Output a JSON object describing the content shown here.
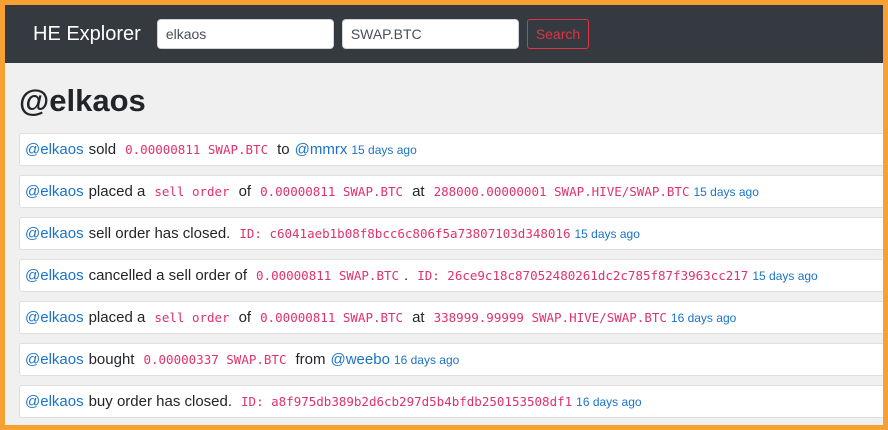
{
  "navbar": {
    "brand": "HE Explorer",
    "account_input_value": "elkaos",
    "symbol_input_value": "SWAP.BTC",
    "search_label": "Search"
  },
  "page": {
    "title": "@elkaos"
  },
  "entries": [
    {
      "user": "@elkaos",
      "text1": "sold",
      "amount": "0.00000811 SWAP.BTC",
      "text2": "to",
      "counterparty": "@mmrx",
      "time": "15 days ago"
    },
    {
      "user": "@elkaos",
      "text1": "placed a",
      "order_type": "sell order",
      "text2": "of",
      "amount": "0.00000811 SWAP.BTC",
      "text3": "at",
      "price": "288000.00000001 SWAP.HIVE/SWAP.BTC",
      "time": "15 days ago"
    },
    {
      "user": "@elkaos",
      "text1": "sell order has closed.",
      "order_id": "ID: c6041aeb1b08f8bcc6c806f5a73807103d348016",
      "time": "15 days ago"
    },
    {
      "user": "@elkaos",
      "text1": "cancelled a sell order of",
      "amount": "0.00000811 SWAP.BTC",
      "text2": ".",
      "order_id": "ID: 26ce9c18c87052480261dc2c785f87f3963cc217",
      "time": "15 days ago"
    },
    {
      "user": "@elkaos",
      "text1": "placed a",
      "order_type": "sell order",
      "text2": "of",
      "amount": "0.00000811 SWAP.BTC",
      "text3": "at",
      "price": "338999.99999 SWAP.HIVE/SWAP.BTC",
      "time": "16 days ago"
    },
    {
      "user": "@elkaos",
      "text1": "bought",
      "amount": "0.00000337 SWAP.BTC",
      "text2": "from",
      "counterparty": "@weebo",
      "time": "16 days ago"
    },
    {
      "user": "@elkaos",
      "text1": "buy order has closed.",
      "order_id": "ID: a8f975db389b2d6cb297d5b4bfdb250153508df1",
      "time": "16 days ago"
    }
  ],
  "colors": {
    "navbar_bg": "#343a40",
    "page_bg": "#f0f0f0",
    "frame_border": "#f7a134",
    "link": "#1a73c7",
    "code": "#e0316f",
    "search_button": "#dc3545"
  }
}
